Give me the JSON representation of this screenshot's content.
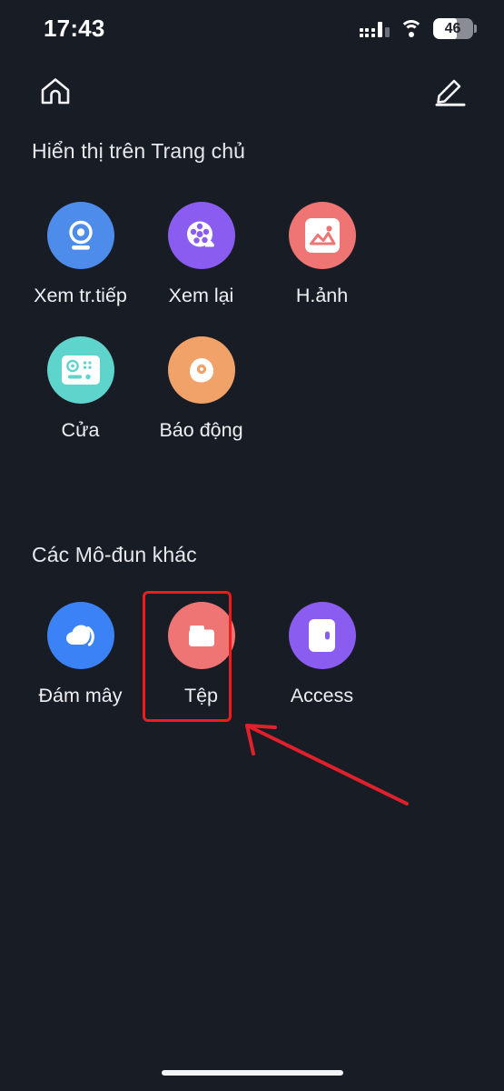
{
  "status_bar": {
    "time": "17:43",
    "signal_icon": "cellular-signal-icon",
    "wifi_icon": "wifi-icon",
    "battery_percent": "46",
    "battery_icon": "battery-icon"
  },
  "nav_bar": {
    "home_icon": "home-icon",
    "edit_icon": "edit-pencil-icon"
  },
  "sections": [
    {
      "id": "home",
      "title": "Hiển thị trên Trang chủ",
      "tiles": [
        {
          "label": "Xem tr.tiếp",
          "icon": "camera-icon",
          "color": "#4d8ceb"
        },
        {
          "label": "Xem lại",
          "icon": "film-reel-icon",
          "color": "#8b5cf0"
        },
        {
          "label": "H.ảnh",
          "icon": "image-icon",
          "color": "#ef7575"
        },
        {
          "label": "Cửa",
          "icon": "door-access-icon",
          "color": "#5fd4cd"
        },
        {
          "label": "Báo động",
          "icon": "alarm-icon",
          "color": "#f0a269"
        }
      ]
    },
    {
      "id": "other",
      "title": "Các Mô-đun khác",
      "tiles": [
        {
          "label": "Đám mây",
          "icon": "cloud-icon",
          "color": "#3b82f6"
        },
        {
          "label": "Tệp",
          "icon": "folder-icon",
          "color": "#ef7575"
        },
        {
          "label": "Access",
          "icon": "access-door-icon",
          "color": "#8b5cf0"
        }
      ]
    }
  ],
  "annotation": {
    "highlight_color": "#f01b1b",
    "highlight_target_label": "Tệp",
    "arrow_icon": "pointer-arrow-icon"
  },
  "system": {
    "home_indicator": "home-indicator-bar",
    "background_color": "#181c24"
  }
}
